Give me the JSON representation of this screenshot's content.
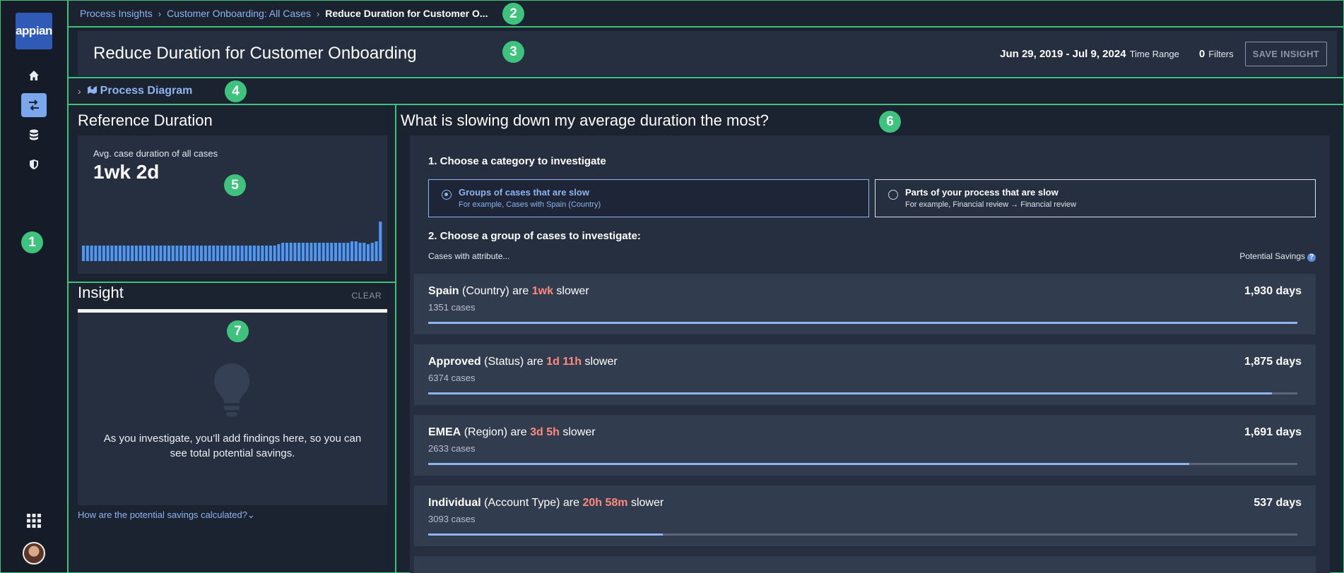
{
  "sidebar": {
    "logo": "appian",
    "items": [
      {
        "name": "home-icon",
        "active": false
      },
      {
        "name": "process-icon",
        "active": true
      },
      {
        "name": "database-icon",
        "active": false
      },
      {
        "name": "shield-icon",
        "active": false
      }
    ],
    "apps_icon": "grid-icon"
  },
  "breadcrumb": {
    "items": [
      "Process Insights",
      "Customer Onboarding: All Cases"
    ],
    "current": "Reduce Duration for Customer O..."
  },
  "header": {
    "title": "Reduce Duration for Customer Onboarding",
    "date_range": "Jun 29, 2019 - Jul 9, 2024",
    "time_range_label": "Time Range",
    "filters_count": "0",
    "filters_label": "Filters",
    "save_label": "SAVE INSIGHT"
  },
  "process_diagram": {
    "label": "Process Diagram"
  },
  "reference": {
    "title": "Reference Duration",
    "avg_label": "Avg. case duration of all cases",
    "avg_value": "1wk 2d",
    "chart_data": {
      "type": "bar",
      "values": [
        11,
        11,
        11,
        11,
        11,
        11,
        11,
        11,
        11,
        11,
        11,
        11,
        11,
        11,
        11,
        11,
        11,
        11,
        11,
        11,
        11,
        11,
        11,
        11,
        11,
        11,
        11,
        11,
        11,
        11,
        11,
        11,
        11,
        11,
        11,
        11,
        11,
        11,
        11,
        11,
        11,
        11,
        11,
        11,
        11,
        11,
        11,
        11,
        12,
        13,
        13,
        13,
        13,
        13,
        13,
        13,
        13,
        13,
        13,
        13,
        13,
        13,
        13,
        13,
        13,
        13,
        14,
        14,
        13,
        13,
        12,
        13,
        14,
        28
      ]
    }
  },
  "insight": {
    "title": "Insight",
    "clear_label": "CLEAR",
    "empty_text": "As you investigate, you’ll add findings here, so you can see total potential savings.",
    "help_link": "How are the potential savings calculated?⌄"
  },
  "main": {
    "title": "What is slowing down my average duration the most?",
    "step1": "1. Choose a category to investigate",
    "options": [
      {
        "title": "Groups of cases that are slow",
        "subtitle": "For example, Cases with Spain (Country)",
        "selected": true
      },
      {
        "title": "Parts of your process that are slow",
        "subtitle": "For example, Financial review → Financial review",
        "selected": false
      }
    ],
    "step2": "2. Choose a group of cases to investigate:",
    "col_left": "Cases with attribute...",
    "col_right": "Potential Savings",
    "help_icon": "?",
    "rows": [
      {
        "value": "Spain",
        "attribute": "(Country) are",
        "slower_by": "1wk",
        "suffix": "slower",
        "cases": "1351 cases",
        "savings": "1,930 days",
        "ratio": 1.0
      },
      {
        "value": "Approved",
        "attribute": "(Status) are",
        "slower_by": "1d 11h",
        "suffix": "slower",
        "cases": "6374 cases",
        "savings": "1,875 days",
        "ratio": 0.971
      },
      {
        "value": "EMEA",
        "attribute": "(Region) are",
        "slower_by": "3d 5h",
        "suffix": "slower",
        "cases": "2633 cases",
        "savings": "1,691 days",
        "ratio": 0.876
      },
      {
        "value": "Individual",
        "attribute": "(Account Type) are",
        "slower_by": "20h 58m",
        "suffix": "slower",
        "cases": "3093 cases",
        "savings": "537 days",
        "ratio": 0.27
      }
    ]
  },
  "annotations": [
    "1",
    "2",
    "3",
    "4",
    "5",
    "6",
    "7"
  ]
}
